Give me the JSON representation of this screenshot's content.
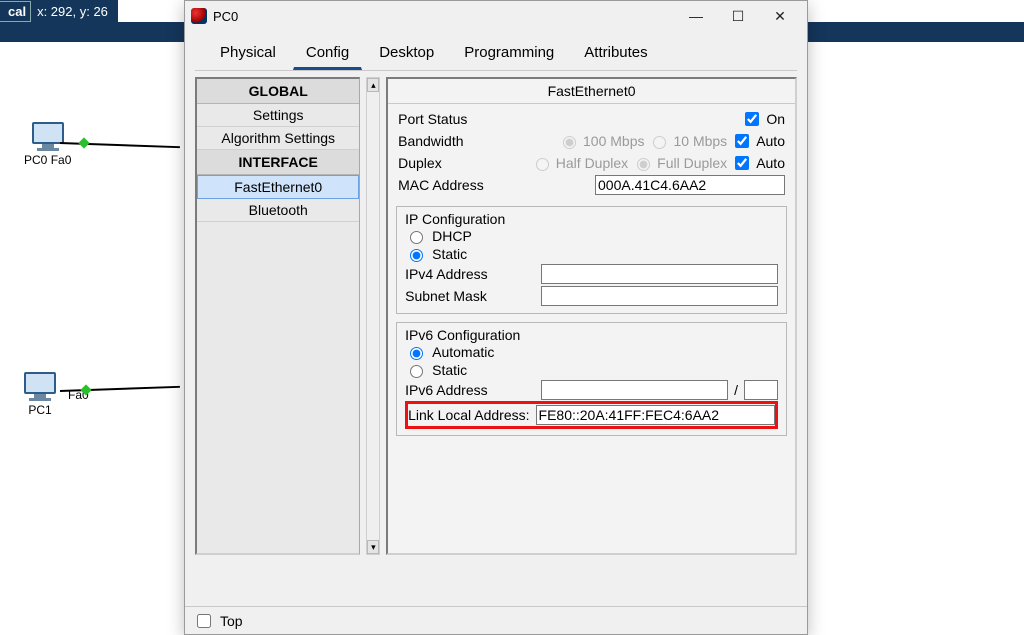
{
  "topbar": {
    "tab": "cal",
    "coords": "x: 292, y: 26"
  },
  "topology": {
    "pc0": {
      "name": "PC0",
      "port": "Fa0"
    },
    "pc1": {
      "name": "PC1",
      "port": "Fa0"
    }
  },
  "window": {
    "title": "PC0",
    "tabs": [
      "Physical",
      "Config",
      "Desktop",
      "Programming",
      "Attributes"
    ],
    "active_tab": "Config",
    "left": {
      "global_hdr": "GLOBAL",
      "settings": "Settings",
      "algo": "Algorithm Settings",
      "iface_hdr": "INTERFACE",
      "fe0": "FastEthernet0",
      "bt": "Bluetooth"
    },
    "iface_title": "FastEthernet0",
    "port_status": {
      "label": "Port Status",
      "on_label": "On",
      "on": true
    },
    "bandwidth": {
      "label": "Bandwidth",
      "opt100": "100 Mbps",
      "opt10": "10 Mbps",
      "auto_label": "Auto",
      "auto": true
    },
    "duplex": {
      "label": "Duplex",
      "half": "Half Duplex",
      "full": "Full Duplex",
      "auto_label": "Auto",
      "auto": true
    },
    "mac": {
      "label": "MAC Address",
      "value": "000A.41C4.6AA2"
    },
    "ipcfg": {
      "title": "IP Configuration",
      "dhcp": "DHCP",
      "static": "Static",
      "ipv4_label": "IPv4 Address",
      "ipv4_value": "",
      "mask_label": "Subnet Mask",
      "mask_value": ""
    },
    "ipv6cfg": {
      "title": "IPv6 Configuration",
      "auto": "Automatic",
      "static": "Static",
      "addr_label": "IPv6 Address",
      "addr_value": "",
      "prefix_sep": "/",
      "ll_label": "Link Local Address:",
      "ll_value": "FE80::20A:41FF:FEC4:6AA2"
    },
    "statusbar": {
      "top": "Top"
    }
  }
}
